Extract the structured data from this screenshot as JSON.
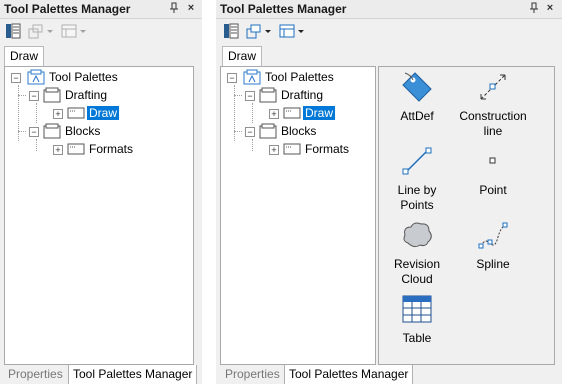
{
  "left_panel": {
    "title": "Tool Palettes Manager",
    "pin_icon": "pin-icon",
    "close_icon": "close-icon",
    "tab": "Draw",
    "tree": [
      {
        "label": "Tool Palettes"
      },
      {
        "label": "Drafting"
      },
      {
        "label": "Draw"
      },
      {
        "label": "Blocks"
      },
      {
        "label": "Formats"
      }
    ],
    "bottom_tabs": {
      "properties": "Properties",
      "manager": "Tool Palettes Manager"
    }
  },
  "right_panel": {
    "title": "Tool Palettes Manager",
    "pin_icon": "pin-icon",
    "close_icon": "close-icon",
    "tab": "Draw",
    "tree": [
      {
        "label": "Tool Palettes"
      },
      {
        "label": "Drafting"
      },
      {
        "label": "Draw"
      },
      {
        "label": "Blocks"
      },
      {
        "label": "Formats"
      }
    ],
    "tools": [
      {
        "label": "AttDef",
        "icon": "attdef-tag-icon"
      },
      {
        "label": "Construction\nline",
        "icon": "construction-line-icon"
      },
      {
        "label": "Line by\nPoints",
        "icon": "line-by-points-icon"
      },
      {
        "label": "Point",
        "icon": "point-icon"
      },
      {
        "label": "Revision\nCloud",
        "icon": "revision-cloud-icon"
      },
      {
        "label": "Spline",
        "icon": "spline-icon"
      },
      {
        "label": "Table",
        "icon": "table-icon"
      }
    ],
    "bottom_tabs": {
      "properties": "Properties",
      "manager": "Tool Palettes Manager"
    }
  },
  "colors": {
    "selection": "#0078d7",
    "tree_bg": "#ffffff",
    "panel_bg": "#f0f0f0",
    "icon_blue": "#1e6fbf",
    "node_blue": "#2a78c8"
  }
}
